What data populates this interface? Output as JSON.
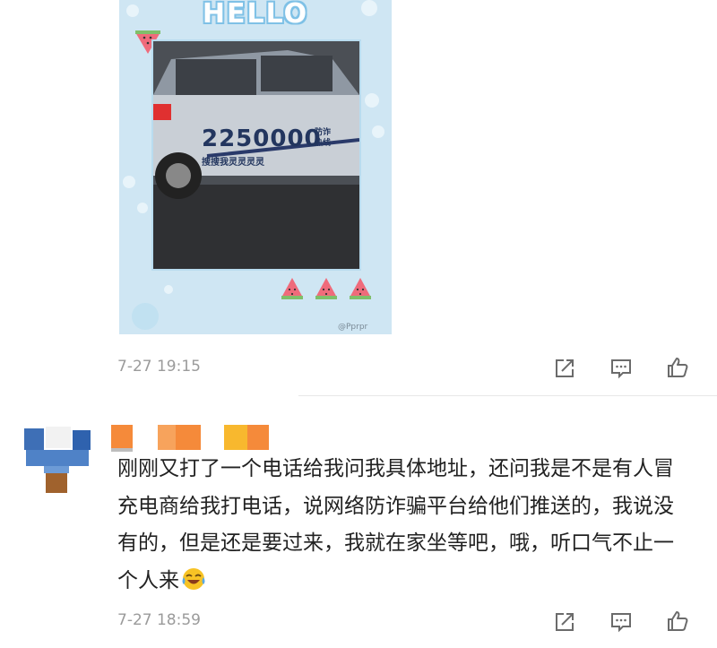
{
  "image_card": {
    "title": "HELLO",
    "photo": {
      "number": "2250000",
      "side_text": "防诈\n热线",
      "small_text": "搜搜我灵灵灵灵"
    },
    "watermark": "@Pprpr"
  },
  "post1": {
    "timestamp": "7-27 19:15",
    "icons": [
      "share-icon",
      "comment-icon",
      "like-icon"
    ]
  },
  "comment": {
    "username_redacted": true,
    "text": "刚刚又打了一个电话给我问我具体地址，还问我是不是有人冒充电商给我打电话，说网络防诈骗平台给他们推送的，我说没有的，但是还是要过来，我就在家坐等吧，哦，听口气不止一个人来",
    "emoji": "laugh-cry-emoji",
    "timestamp": "7-27 18:59",
    "icons": [
      "share-icon",
      "comment-icon",
      "like-icon"
    ]
  },
  "colors": {
    "card_bg": "#cfe6f3",
    "timestamp": "#9b9b9b",
    "icon": "#6b6b6b",
    "text": "#222222",
    "redact_orange": "#f58a3a",
    "redact_yellow": "#f8b82e"
  }
}
